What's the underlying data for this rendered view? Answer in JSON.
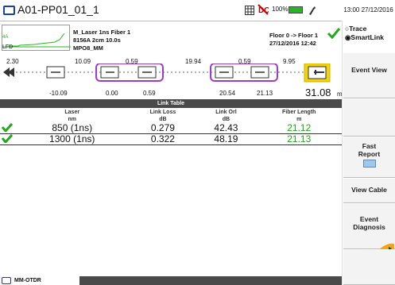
{
  "header": {
    "title": "A01-PP01_01_1",
    "battery_percent": "100%",
    "time": "13:00 27/12/2016"
  },
  "info": {
    "line1": "M_Laser 1ns  Fiber 1",
    "line2": "8156A  2cm  10.0s",
    "line3": "MPO8_MM",
    "fiber_route": "Floor 0 -> Floor 1",
    "datetime": "27/12/2016  12:42",
    "lfd_label": "LFD",
    "mini_left": "4A"
  },
  "ruler": {
    "top": [
      "2.30",
      "10.09",
      "0.59",
      "19.94",
      "0.59",
      "9.95"
    ],
    "bottom": [
      "-10.09",
      "0.00",
      "0.59",
      "20.54",
      "21.13"
    ],
    "end_value": "31.08",
    "unit": "m"
  },
  "table": {
    "title": "Link Table",
    "columns": [
      {
        "label": "Laser",
        "unit": "nm"
      },
      {
        "label": "Link Loss",
        "unit": "dB"
      },
      {
        "label": "Link Orl",
        "unit": "dB"
      },
      {
        "label": "Fiber Length",
        "unit": "m"
      }
    ],
    "rows": [
      {
        "laser": "850 (1ns)",
        "loss": "0.279",
        "orl": "42.43",
        "length": "21.12"
      },
      {
        "laser": "1300 (1ns)",
        "loss": "0.322",
        "orl": "48.19",
        "length": "21.13"
      }
    ]
  },
  "side": {
    "trace": "Trace",
    "smartlink": "SmartLink",
    "event_view": "Event View",
    "fast_report": "Fast Report",
    "view_cable": "View Cable",
    "event_diagnosis": "Event Diagnosis"
  },
  "bottom": {
    "tab_label": "MM-OTDR"
  },
  "colors": {
    "pass": "#22a81e",
    "group": "#9b3fc1",
    "highlight": "#f2d20a",
    "bar": "#4a4a4a"
  }
}
